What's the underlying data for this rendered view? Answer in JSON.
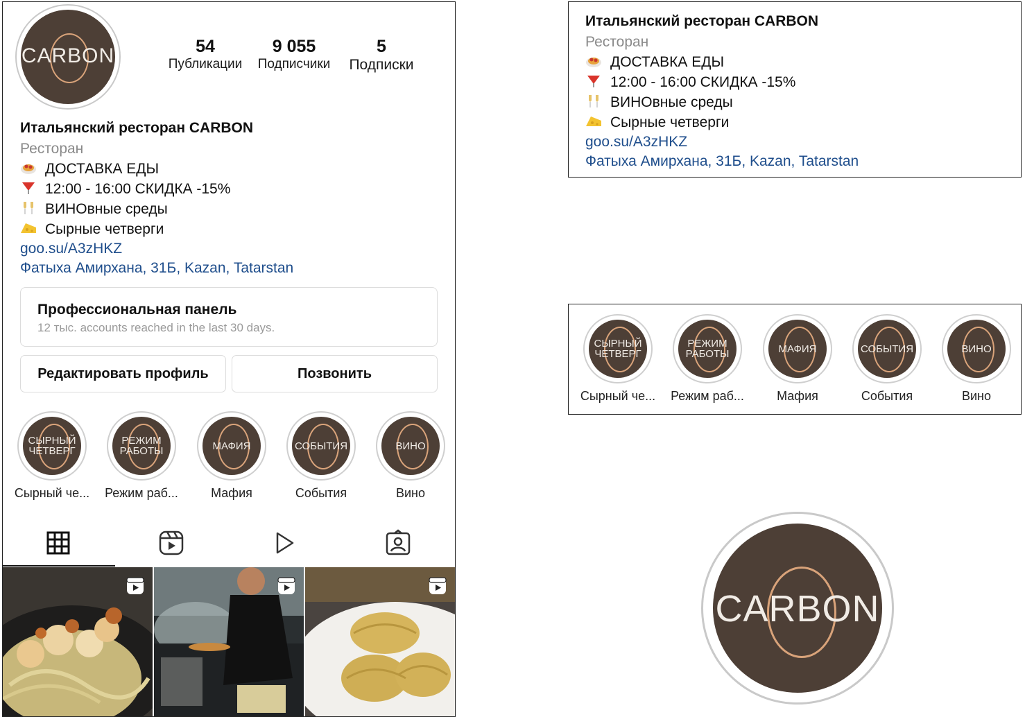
{
  "profile": {
    "logo_text": "CARBON",
    "stats": [
      {
        "num": "54",
        "label": "Публикации"
      },
      {
        "num": "9 055",
        "label": "Подписчики"
      },
      {
        "num": "5",
        "label": "Подписки"
      }
    ]
  },
  "bio": {
    "name": "Итальянский ресторан CARBON",
    "category": "Ресторан",
    "lines": [
      {
        "icon": "spaghetti-icon",
        "text": "ДОСТАВКА ЕДЫ"
      },
      {
        "icon": "wine-glass-icon",
        "text": "12:00 - 16:00 СКИДКА -15%"
      },
      {
        "icon": "champagne-icon",
        "text": "ВИНОвные среды"
      },
      {
        "icon": "cheese-icon",
        "text": "Сырные четверги"
      }
    ],
    "link": "goo.su/A3zHKZ",
    "address": "Фатыха Амирхана, 31Б, Kazan, Tatarstan"
  },
  "dashboard": {
    "title": "Профессиональная панель",
    "subtitle": "12 тыс. accounts reached in the last 30 days."
  },
  "buttons": {
    "edit": "Редактировать профиль",
    "call": "Позвонить"
  },
  "highlights": [
    {
      "cover": "СЫРНЫЙ ЧЕТВЕРГ",
      "caption": "Сырный че..."
    },
    {
      "cover": "РЕЖИМ РАБОТЫ",
      "caption": "Режим раб..."
    },
    {
      "cover": "МАФИЯ",
      "caption": "Мафия"
    },
    {
      "cover": "СОБЫТИЯ",
      "caption": "События"
    },
    {
      "cover": "ВИНО",
      "caption": "Вино"
    }
  ],
  "tabs": [
    {
      "icon": "grid-icon",
      "active": true
    },
    {
      "icon": "reels-icon",
      "active": false
    },
    {
      "icon": "play-icon",
      "active": false
    },
    {
      "icon": "tagged-icon",
      "active": false
    }
  ],
  "colors": {
    "logo_bg": "#4d3f36",
    "logo_arc": "#d9a37a",
    "link": "#1f4e8c"
  }
}
